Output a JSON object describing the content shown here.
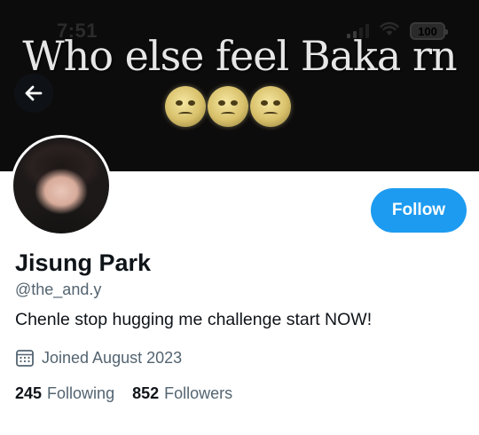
{
  "status_bar": {
    "time": "7:51",
    "battery": "100"
  },
  "header": {
    "caption": "Who else feel Baka rn",
    "emoji_icon": "pleading-face-emoji",
    "emoji_count": 3,
    "back_icon": "arrow-left-icon"
  },
  "profile": {
    "display_name": "Jisung Park",
    "handle": "@the_and.y",
    "bio": "Chenle stop hugging me challenge start NOW!",
    "joined": "Joined August 2023",
    "calendar_icon": "calendar-icon",
    "follow_label": "Follow"
  },
  "stats": {
    "following_count": "245",
    "following_label": "Following",
    "followers_count": "852",
    "followers_label": "Followers"
  },
  "colors": {
    "accent": "#1d9bf0",
    "secondary_text": "#536471",
    "primary_text": "#0f1419"
  }
}
